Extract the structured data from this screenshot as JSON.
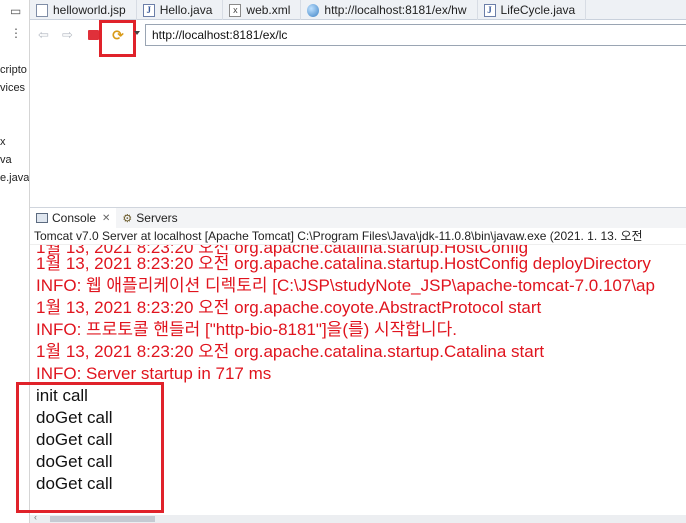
{
  "left_panel": {
    "fragments": [
      "cripto",
      "vices",
      "x",
      "va",
      "e.java"
    ]
  },
  "editor_tabs": [
    {
      "label": "helloworld.jsp",
      "icon": "jsp-file-icon"
    },
    {
      "label": "Hello.java",
      "icon": "java-file-icon"
    },
    {
      "label": "web.xml",
      "icon": "xml-file-icon"
    },
    {
      "label": "http://localhost:8181/ex/hw",
      "icon": "globe-icon"
    },
    {
      "label": "LifeCycle.java",
      "icon": "java-file-icon"
    }
  ],
  "browser": {
    "url": "http://localhost:8181/ex/lc",
    "back_glyph": "⇦",
    "forward_glyph": "⇨",
    "refresh_glyph": "⟳"
  },
  "console_view": {
    "tabs": [
      {
        "label": "Console",
        "active": true
      },
      {
        "label": "Servers",
        "active": false
      }
    ],
    "close_glyph": "✕",
    "header": "Tomcat v7.0 Server at localhost [Apache Tomcat] C:\\Program Files\\Java\\jdk-11.0.8\\bin\\javaw.exe  (2021. 1. 13. 오전",
    "lines": [
      {
        "text": "1월 13, 2021 8:23:20 오전 org.apache.catalina.startup.HostConfig deployDirectory",
        "color": "red"
      },
      {
        "text": "INFO: 웹 애플리케이션 디렉토리 [C:\\JSP\\studyNote_JSP\\apache-tomcat-7.0.107\\ap",
        "color": "red"
      },
      {
        "text": "1월 13, 2021 8:23:20 오전 org.apache.coyote.AbstractProtocol start",
        "color": "red"
      },
      {
        "text": "INFO: 프로토콜 핸들러 [\"http-bio-8181\"]을(를) 시작합니다.",
        "color": "red"
      },
      {
        "text": "1월 13, 2021 8:23:20 오전 org.apache.catalina.startup.Catalina start",
        "color": "red"
      },
      {
        "text": "INFO: Server startup in 717 ms",
        "color": "red"
      },
      {
        "text": "init call",
        "color": "black"
      },
      {
        "text": "doGet call",
        "color": "black"
      },
      {
        "text": "doGet call",
        "color": "black"
      },
      {
        "text": "doGet call",
        "color": "black"
      },
      {
        "text": "doGet call",
        "color": "black"
      }
    ]
  },
  "colors": {
    "error_text": "#e0141e",
    "highlight_box": "#e0222a",
    "stop_button": "#e0303a"
  }
}
